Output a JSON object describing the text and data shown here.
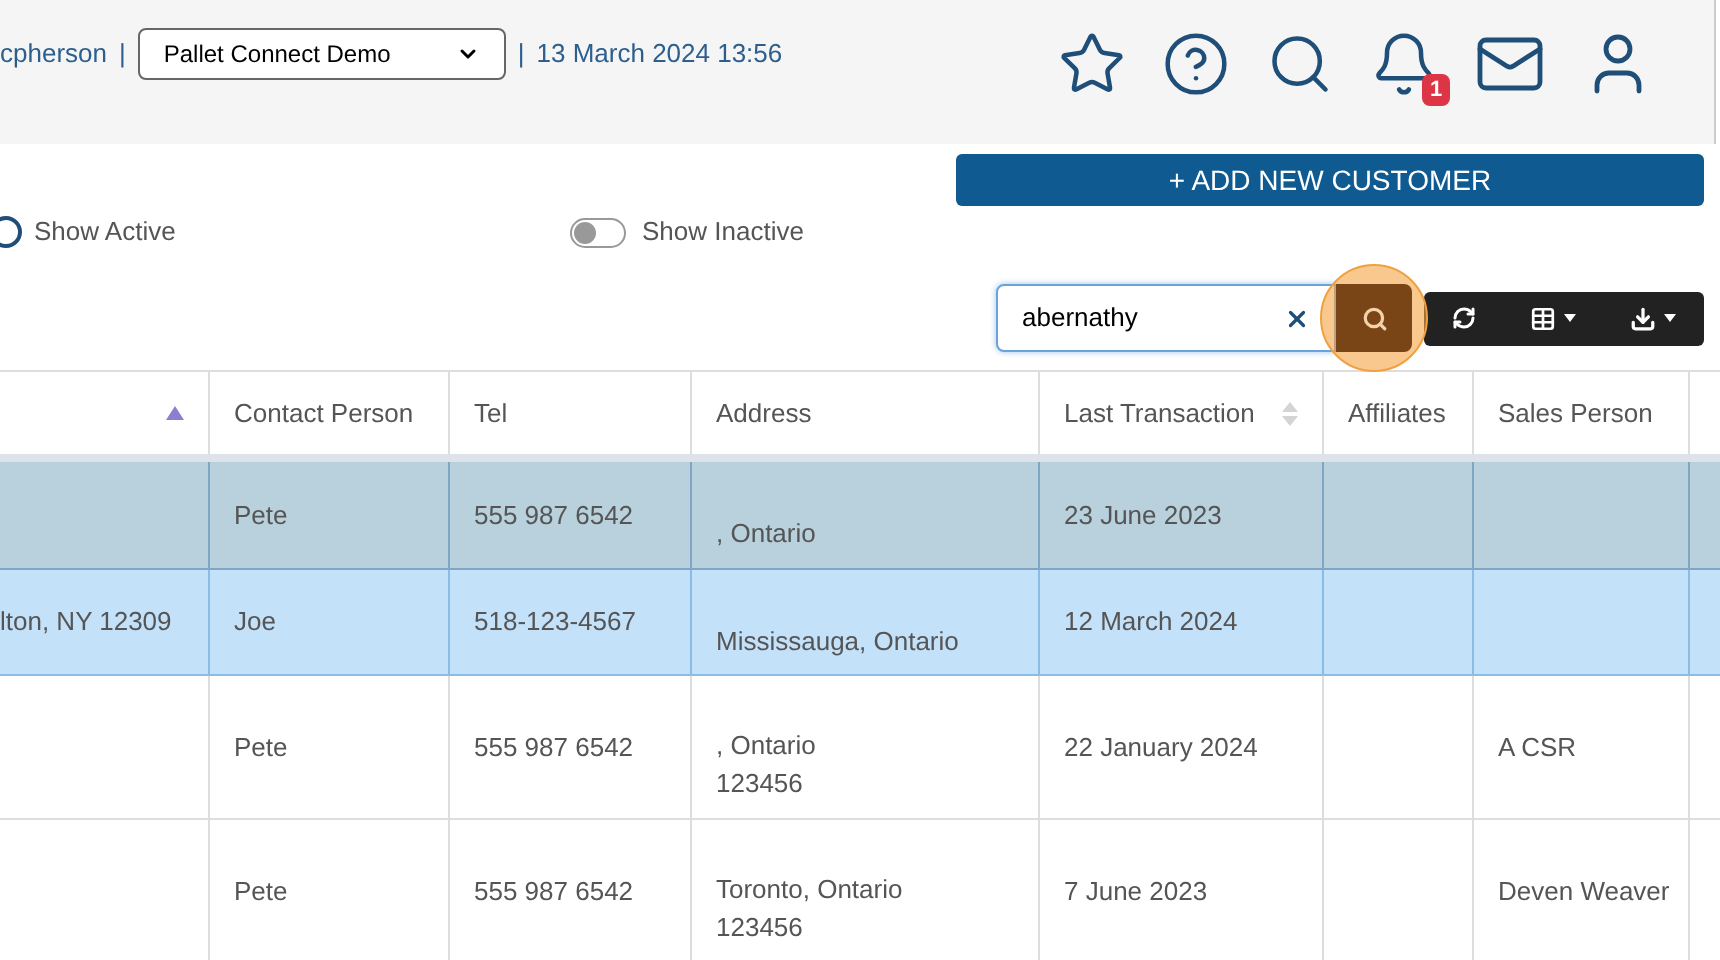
{
  "header": {
    "user_fragment": "cpherson",
    "separator": "|",
    "company_select": {
      "value": "Pallet Connect Demo"
    },
    "datetime_separator": "|",
    "datetime": "13 March 2024 13:56",
    "notification_count": "1"
  },
  "add_button": {
    "label": "+ ADD NEW CUSTOMER"
  },
  "filters": [
    {
      "kind": "radio",
      "label": "Show Active",
      "on": false
    },
    {
      "kind": "toggle",
      "label": "Show Inactive",
      "on": false
    }
  ],
  "search": {
    "value": "abernathy",
    "highlighted": true
  },
  "columns": [
    {
      "sorted_ascending": true
    },
    {
      "label": "Contact Person"
    },
    {
      "label": "Tel"
    },
    {
      "label": "Address"
    },
    {
      "label": "Last Transaction",
      "sortable": true
    },
    {
      "label": "Affiliates"
    },
    {
      "label": "Sales Person"
    }
  ],
  "rows": [
    {
      "contact": "Pete",
      "tel": "555 987 6542",
      "address": [
        ", Ontario"
      ],
      "last_transaction": "23 June 2023",
      "selected": true,
      "hovered": false
    },
    {
      "column_1": "lton, NY 12309",
      "contact": "Joe",
      "tel": "518-123-4567",
      "address": [
        "Mississauga, Ontario"
      ],
      "last_transaction": "12 March 2024",
      "selected": false,
      "hovered": true
    },
    {
      "contact": "Pete",
      "tel": "555 987 6542",
      "address": [
        ", Ontario",
        "123456"
      ],
      "last_transaction": "22 January 2024",
      "sales_person": "A CSR",
      "selected": false,
      "hovered": false
    },
    {
      "contact": "Pete",
      "tel": "555 987 6542",
      "address": [
        "Toronto, Ontario",
        "123456"
      ],
      "last_transaction": "7 June 2023",
      "sales_person": "Deven Weaver",
      "selected": false,
      "hovered": false
    }
  ]
}
